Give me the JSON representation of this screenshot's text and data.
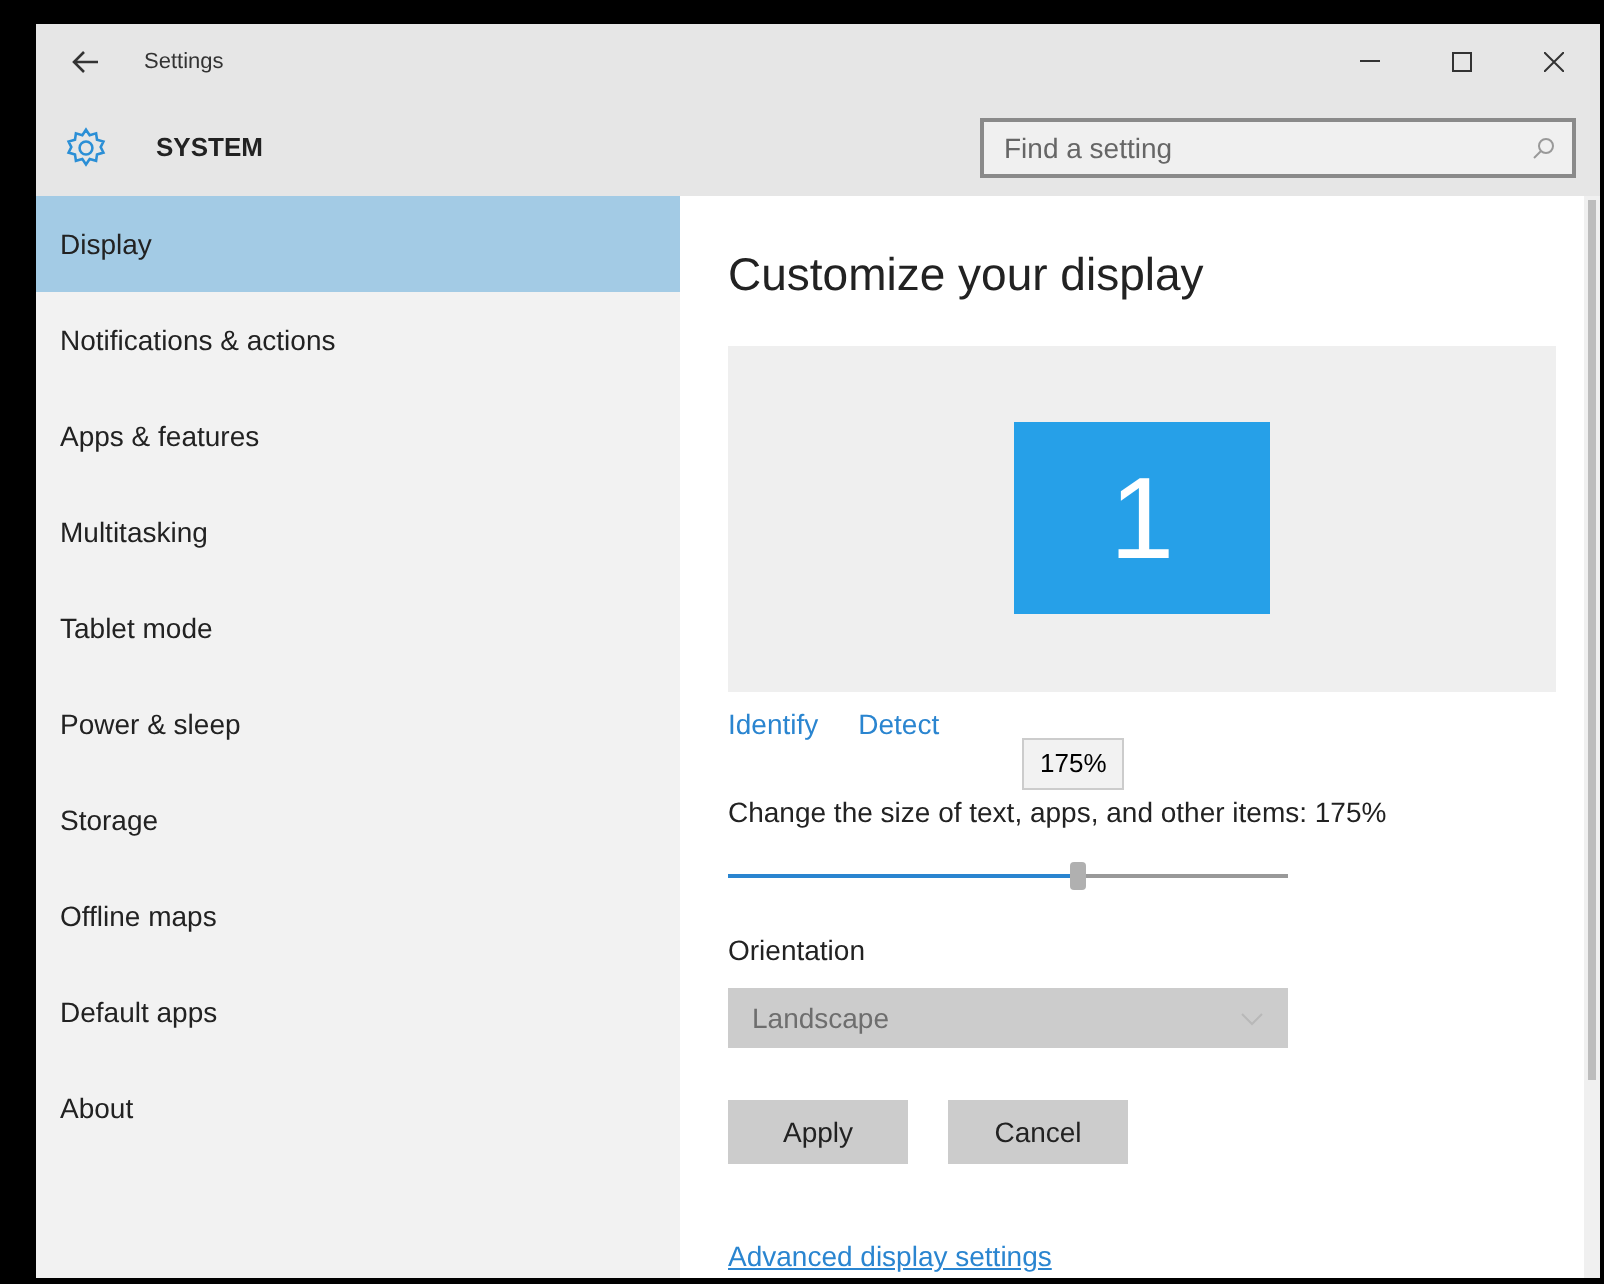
{
  "window": {
    "title": "Settings"
  },
  "header": {
    "title": "SYSTEM",
    "search": {
      "placeholder": "Find a setting"
    }
  },
  "sidebar": {
    "items": [
      {
        "label": "Display",
        "selected": true
      },
      {
        "label": "Notifications & actions",
        "selected": false
      },
      {
        "label": "Apps & features",
        "selected": false
      },
      {
        "label": "Multitasking",
        "selected": false
      },
      {
        "label": "Tablet mode",
        "selected": false
      },
      {
        "label": "Power & sleep",
        "selected": false
      },
      {
        "label": "Storage",
        "selected": false
      },
      {
        "label": "Offline maps",
        "selected": false
      },
      {
        "label": "Default apps",
        "selected": false
      },
      {
        "label": "About",
        "selected": false
      }
    ]
  },
  "content": {
    "title": "Customize your display",
    "monitor": "1",
    "links": [
      "Identify",
      "Detect"
    ],
    "scale": {
      "label": "Change the size of text, apps, and other items: 175%",
      "tooltip": "175%",
      "level": 0.625
    },
    "orientation": {
      "label": "Orientation",
      "value": "Landscape",
      "disabled": true
    },
    "buttons": [
      "Apply",
      "Cancel"
    ],
    "advanced_link": "Advanced display settings"
  }
}
